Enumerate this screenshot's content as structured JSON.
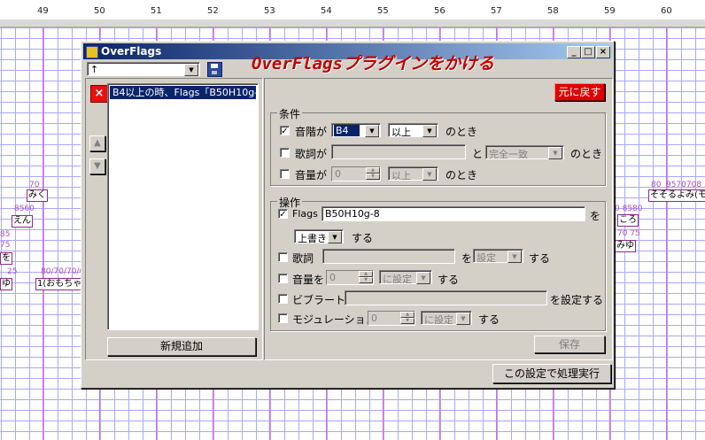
{
  "ruler": [
    "49",
    "50",
    "51",
    "52",
    "53",
    "54",
    "55",
    "56",
    "57",
    "58",
    "59",
    "60"
  ],
  "bg_notes": {
    "left_labels": [
      "70",
      "みく",
      "8560",
      "えん",
      "85",
      "75",
      "を",
      "25",
      "80/70/70/0",
      "ゆ",
      "1(おもちゃ"
    ],
    "right_labels": [
      "80",
      "9570708",
      "そそるよみ(モ",
      "0 8580",
      "ころ",
      "70 75",
      "みゆ"
    ]
  },
  "window": {
    "title": "OverFlags",
    "banner": "OverFlagsプラグインをかける",
    "controls": {
      "minimize": "_",
      "maximize": "□",
      "close": "×"
    }
  },
  "left": {
    "preset_combo": "↑",
    "delete_icon": "×",
    "list_items": [
      "B4以上の時、Flags「B50H10g-8」"
    ],
    "up_icon": "▲",
    "down_icon": "▼",
    "new_button": "新規追加"
  },
  "right": {
    "revert_button": "元に戻す",
    "conditions": {
      "title": "条件",
      "pitch": {
        "checked": true,
        "label": "音階が",
        "value": "B4",
        "operator": "以上",
        "suffix": "のとき"
      },
      "lyric": {
        "checked": false,
        "label": "歌詞が",
        "value": "",
        "connector": "と",
        "match": "完全一致",
        "suffix": "のとき"
      },
      "volume": {
        "checked": false,
        "label": "音量が",
        "value": "0",
        "operator": "以上",
        "suffix": "のとき"
      }
    },
    "operations": {
      "title": "操作",
      "flags": {
        "checked": true,
        "label": "Flags",
        "value": "B50H10g-8",
        "suffix": "を"
      },
      "flags_mode": {
        "value": "上書き",
        "suffix": "する"
      },
      "lyric": {
        "checked": false,
        "label": "歌詞",
        "value": "",
        "connector": "を",
        "mode": "設定",
        "suffix": "する"
      },
      "volume": {
        "checked": false,
        "label": "音量を",
        "value": "0",
        "mode": "に設定",
        "suffix": "する"
      },
      "vibrato": {
        "checked": false,
        "label": "ビブラートに",
        "value": "",
        "suffix": "を設定する"
      },
      "modulation": {
        "checked": false,
        "label": "モジュレーションを",
        "value": "0",
        "mode": "に設定",
        "suffix": "する"
      }
    },
    "save_button": "保存",
    "execute_button": "この設定で処理実行"
  },
  "colors": {
    "accent_red": "#e00000",
    "banner_red": "#c00000",
    "titlebar": "#0a246a"
  }
}
